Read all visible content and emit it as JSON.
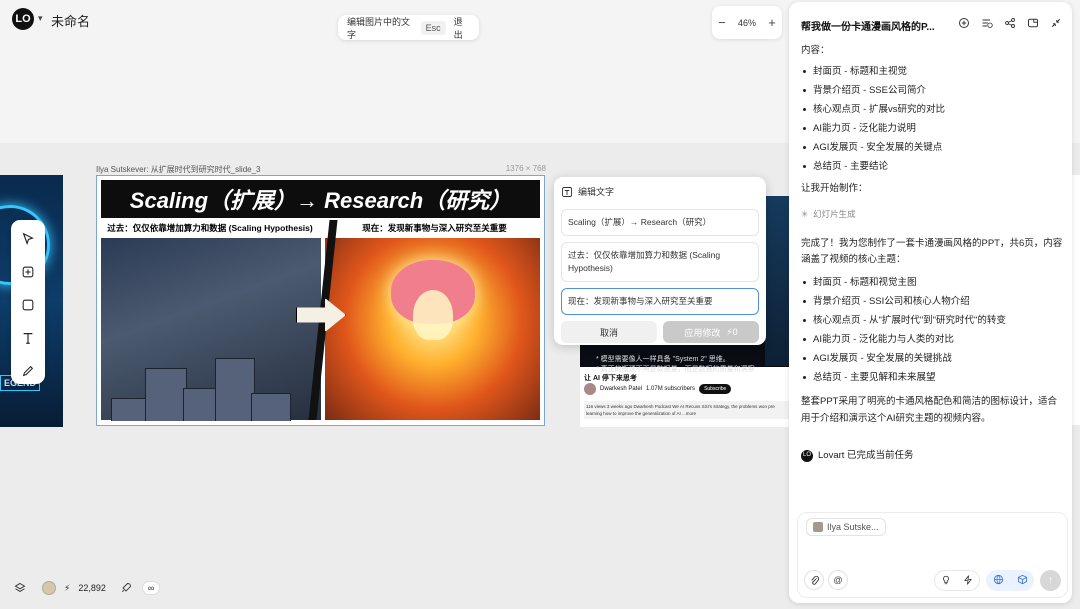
{
  "app": {
    "logo_text": "LO",
    "project_title": "未命名"
  },
  "edit_hint": {
    "text": "编辑图片中的文字",
    "esc": "Esc",
    "exit": "退出"
  },
  "zoom": {
    "minus": "−",
    "level": "46%",
    "plus": "+"
  },
  "slide": {
    "caption": "Ilya Sutskever: 从扩展时代到研究时代_slide_3",
    "dimensions": "1376 × 768",
    "banner": "Scaling（扩展）→ Research（研究）",
    "left_sub": "过去：仅仅依靠增加算力和数据 (Scaling Hypothesis)",
    "right_sub": "现在：发现新事物与深入研究至关重要"
  },
  "left_slide": {
    "label": "EGEND"
  },
  "editor": {
    "title": "编辑文字",
    "fields": [
      "Scaling（扩展）→ Research（研究）",
      "过去：仅仅依靠增加算力和数据 (Scaling Hypothesis)",
      "现在：发现新事物与深入研究至关重要"
    ],
    "cancel": "取消",
    "apply": "应用修改",
    "apply_cost": "0"
  },
  "video_slide": {
    "overlay_line1": "* 模型需要像人一样具备 \"System 2\" 思维。",
    "overlay_line2": "* 真正的瓶颈不再是数据量，而是数据的质量和洞察",
    "title": "让 AI 停下来思考",
    "channel": "Dwarkesh Patel",
    "subscribers": "1.07M subscribers",
    "subscribe": "Subscribe",
    "desc": "116 views 3 weeks ago Dwarkesh Podcast We AI Recuss SSI's strategy, the problems won pre learning how to improve the generalization of AI ...more"
  },
  "chat": {
    "title": "帮我做一份卡通漫画风格的P...",
    "intro": "内容：",
    "plan": [
      "封面页 - 标题和主视觉",
      "背景介绍页 - SSE公司简介",
      "核心观点页 - 扩展vs研究的对比",
      "AI能力页 - 泛化能力说明",
      "AGI发展页 - 安全发展的关键点",
      "总结页 - 主要结论"
    ],
    "start": "让我开始制作：",
    "generating": "幻灯片生成",
    "done_msg": "完成了！我为您制作了一套卡通漫画风格的PPT，共6页，内容涵盖了视频的核心主题：",
    "result": [
      "封面页 - 标题和视觉主图",
      "背景介绍页 - SSI公司和核心人物介绍",
      "核心观点页 - 从\"扩展时代\"到\"研究时代\"的转变",
      "AI能力页 - 泛化能力与人类的对比",
      "AGI发展页 - 安全发展的关键挑战",
      "总结页 - 主要见解和未来展望"
    ],
    "summary": "整套PPT采用了明亮的卡通风格配色和简洁的图标设计，适合用于介绍和演示这个AI研究主题的视频内容。",
    "completed": "Lovart 已完成当前任务",
    "chip": "Ilya Sutske..."
  },
  "bottom": {
    "credits": "22,892",
    "infinity": "∞"
  }
}
